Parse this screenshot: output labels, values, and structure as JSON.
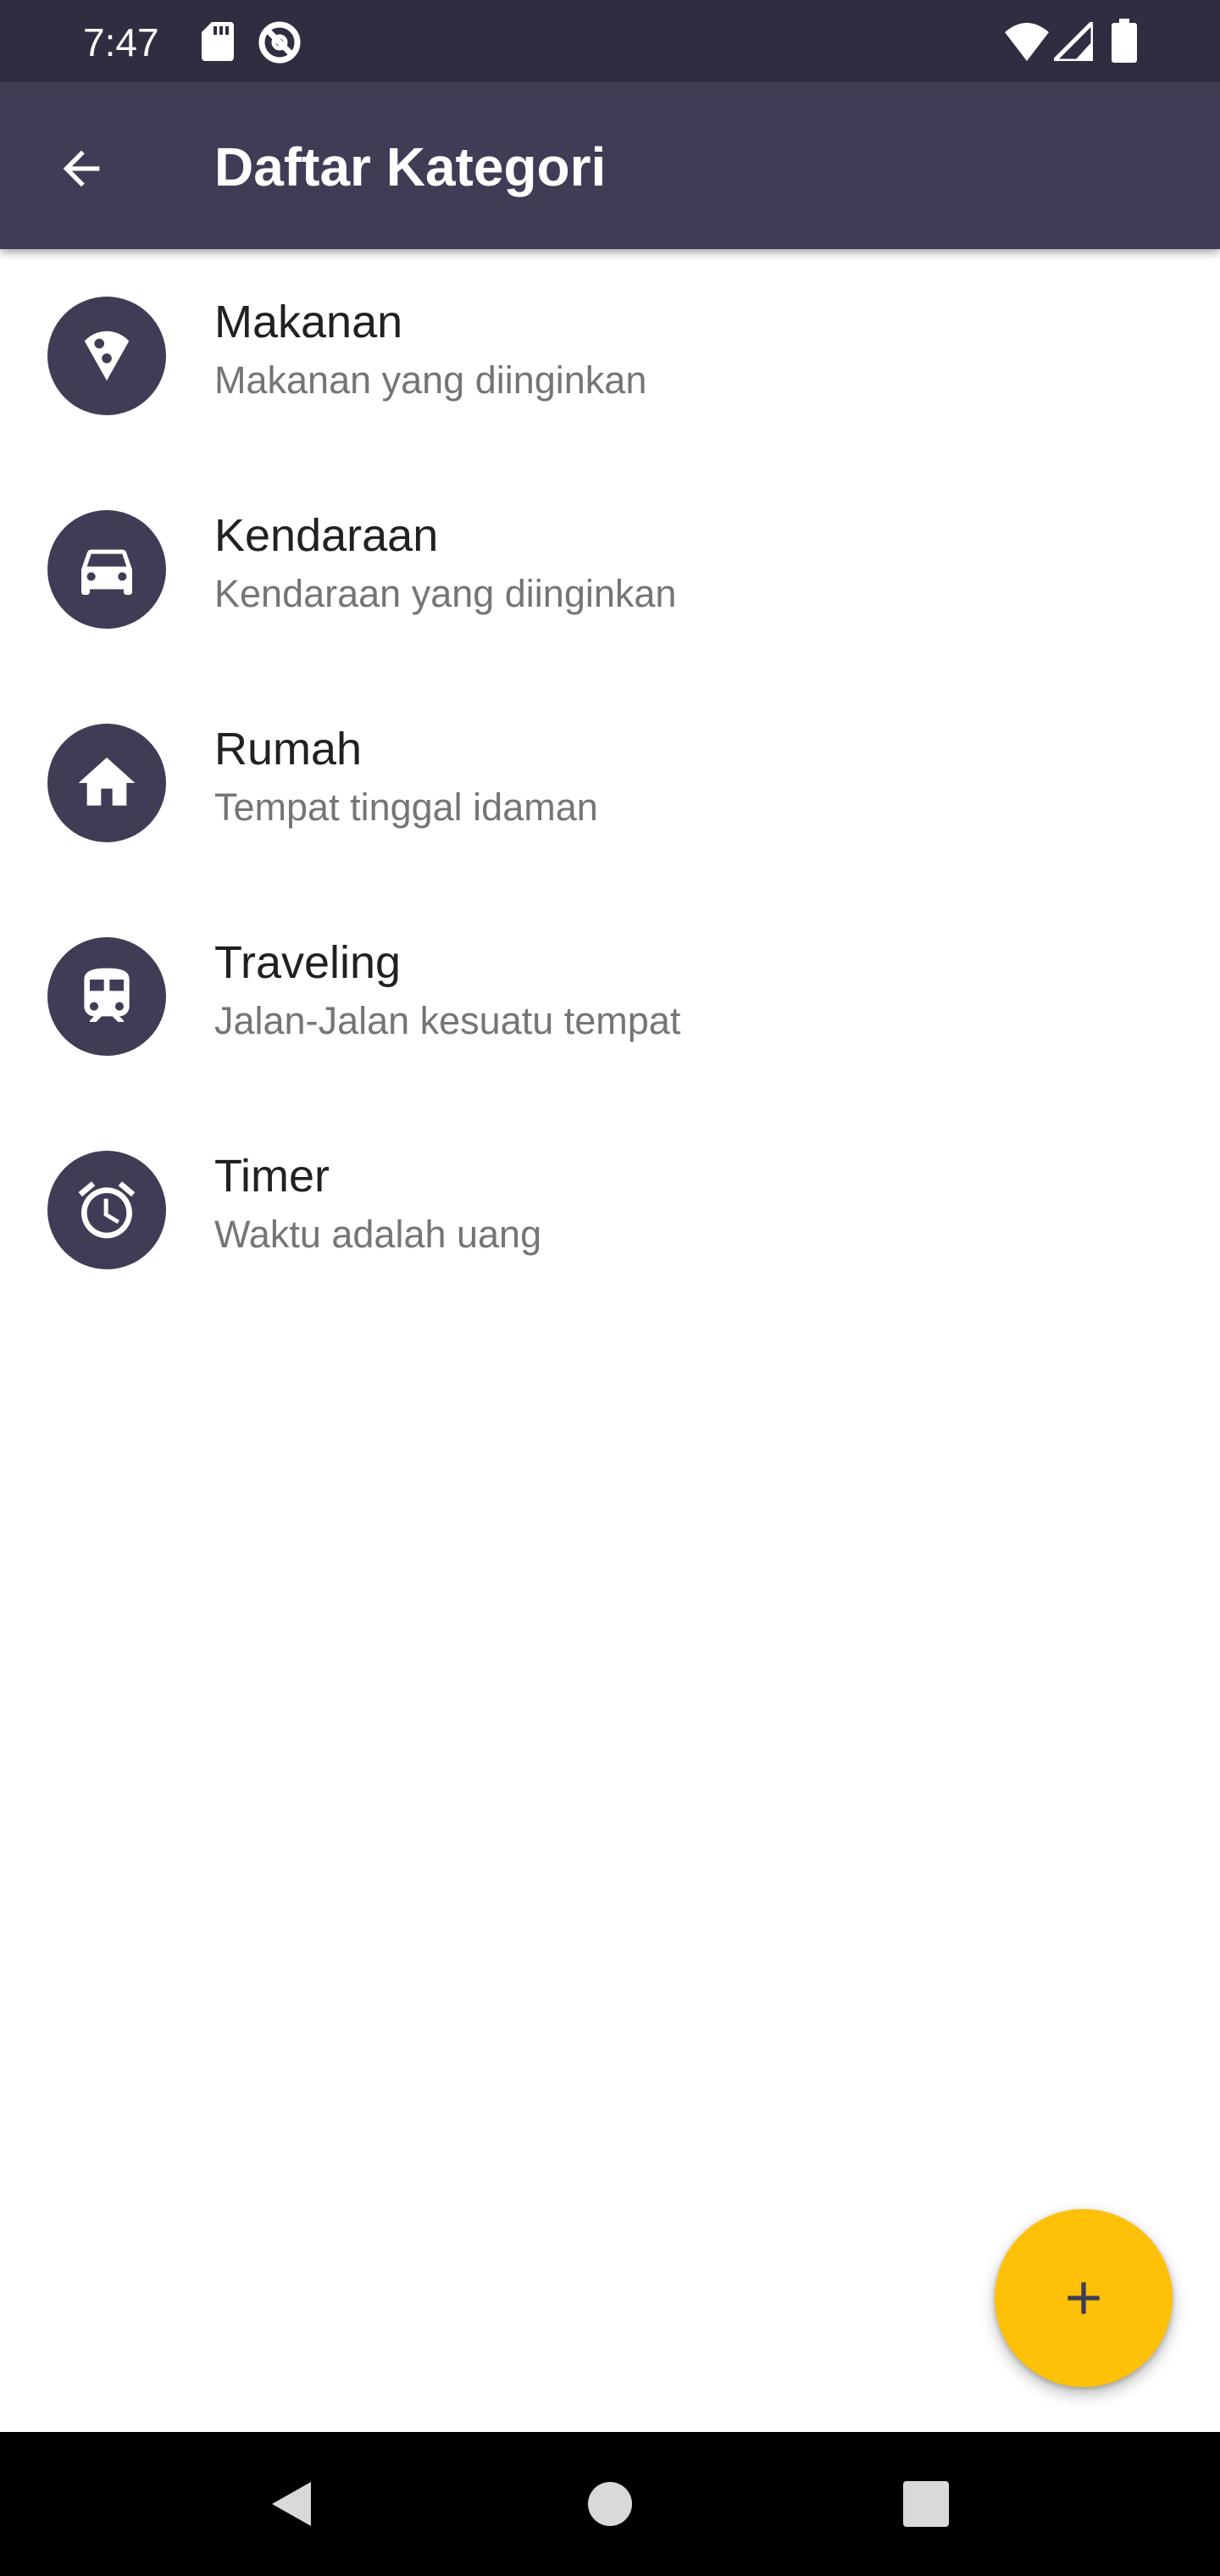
{
  "status_bar": {
    "time": "7:47",
    "left_icons": [
      "sd-card-icon",
      "do-not-disturb-icon"
    ],
    "right_icons": [
      "wifi-icon",
      "cell-signal-icon",
      "battery-icon"
    ]
  },
  "app_bar": {
    "title": "Daftar Kategori",
    "back_icon": "arrow-back-icon"
  },
  "categories": [
    {
      "title": "Makanan",
      "subtitle": "Makanan yang diinginkan",
      "icon": "pizza-icon"
    },
    {
      "title": "Kendaraan",
      "subtitle": "Kendaraan yang diinginkan",
      "icon": "car-icon"
    },
    {
      "title": "Rumah",
      "subtitle": "Tempat tinggal idaman",
      "icon": "home-icon"
    },
    {
      "title": "Traveling",
      "subtitle": "Jalan-Jalan kesuatu tempat",
      "icon": "train-icon"
    },
    {
      "title": "Timer",
      "subtitle": "Waktu adalah uang",
      "icon": "alarm-icon"
    }
  ],
  "fab": {
    "icon": "plus-icon"
  },
  "nav_bar": {
    "icons": [
      "nav-back-icon",
      "nav-home-icon",
      "nav-recents-icon"
    ]
  },
  "colors": {
    "status_bar": "#2f2e41",
    "app_bar": "#3f3d56",
    "avatar": "#3f3d56",
    "fab": "#ffc107",
    "title_text": "#212121",
    "subtitle_text": "#757575"
  }
}
